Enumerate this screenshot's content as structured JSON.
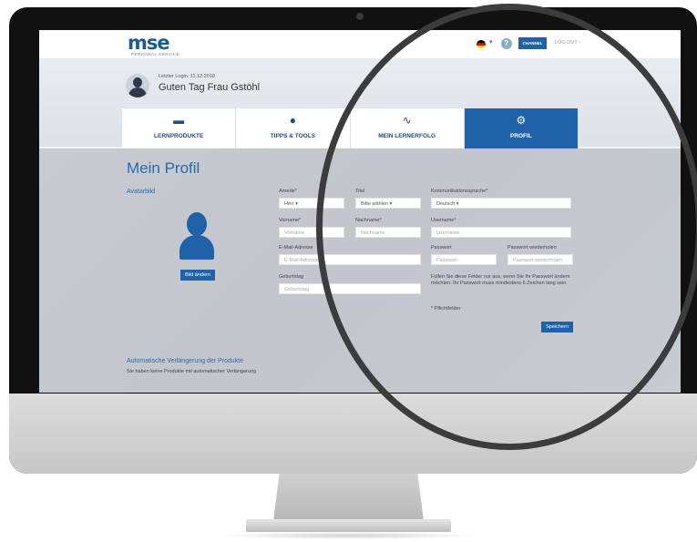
{
  "brand": {
    "logo_text": "mse",
    "logo_sub": "PERSONAL SERVICE",
    "color": "#1f62a8"
  },
  "header": {
    "help_label": "?",
    "channel_label": "CHANNEL",
    "logout_label": "LOG OUT ›"
  },
  "user": {
    "last_login": "Letzter Login: 11.12.2018",
    "greeting": "Guten Tag Frau Gstöhl"
  },
  "nav": [
    {
      "label": "LERNPRODUKTE",
      "icon": "tablet-icon",
      "glyph": "▬"
    },
    {
      "label": "TIPPS & TOOLS",
      "icon": "chat-bubble-icon",
      "glyph": "●"
    },
    {
      "label": "MEIN LERNERFOLG",
      "icon": "trend-chart-icon",
      "glyph": "∿"
    },
    {
      "label": "PROFIL",
      "icon": "gear-icon",
      "glyph": "⚙"
    }
  ],
  "profile": {
    "title": "Mein Profil",
    "avatar_label": "Avatarbild",
    "change_image_button": "Bild ändern",
    "fields": {
      "salutation": {
        "label": "Anrede*",
        "value": "Herr"
      },
      "title": {
        "label": "Titel",
        "value": "Bitte wählen"
      },
      "language": {
        "label": "Kommunikationssprache*",
        "value": "Deutsch"
      },
      "firstname": {
        "label": "Vorname*",
        "placeholder": "Vorname"
      },
      "lastname": {
        "label": "Nachname*",
        "placeholder": "Nachname"
      },
      "username": {
        "label": "Username*",
        "placeholder": "Username"
      },
      "email": {
        "label": "E-Mail-Adresse",
        "placeholder": "E-Mail-Adresse"
      },
      "password": {
        "label": "Passwort",
        "placeholder": "Passwort"
      },
      "password_repeat": {
        "label": "Passwort wiederholen",
        "placeholder": "Passwort wiederholen"
      },
      "birthday": {
        "label": "Geburtstag",
        "placeholder": "Geburtstag"
      }
    },
    "password_hint": "Füllen Sie diese Felder nur aus, wenn Sie Ihr Passwort ändern möchten. Ihr Passwort muss mindestens 6 Zeichen lang sein.",
    "required_note": "* Pflichtfelder",
    "save_button": "Speichern"
  },
  "renewal": {
    "title": "Automatische Verlängerung der Produkte",
    "text": "Sie haben keine Produkte mit automatischer Verlängerung"
  }
}
